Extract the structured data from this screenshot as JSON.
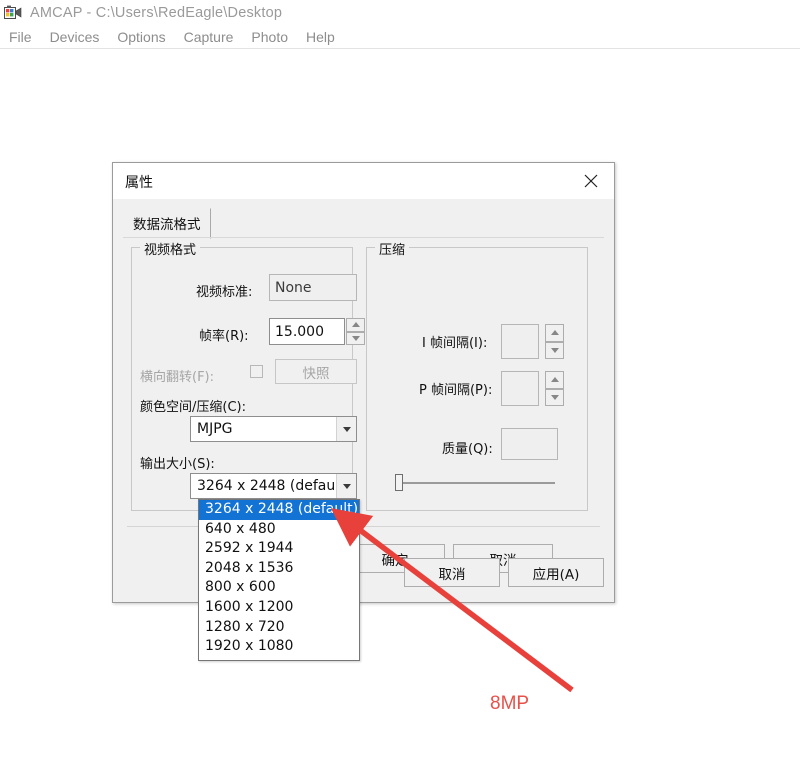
{
  "app": {
    "icon": "camcorder-icon",
    "title": "AMCAP - C:\\Users\\RedEagle\\Desktop",
    "menu": [
      {
        "label": "File"
      },
      {
        "label": "Devices"
      },
      {
        "label": "Options"
      },
      {
        "label": "Capture"
      },
      {
        "label": "Photo"
      },
      {
        "label": "Help"
      }
    ]
  },
  "dialog": {
    "title": "属性",
    "close_icon": "close-icon",
    "tabs": [
      {
        "label": "数据流格式"
      }
    ],
    "video_group": {
      "title": "视频格式",
      "video_standard_label": "视频标准:",
      "video_standard_value": "None",
      "frame_rate_label": "帧率(R):",
      "frame_rate_value": "15.000",
      "flip_horizontal_label": "横向翻转(F):",
      "flip_horizontal_checked": false,
      "snapshot_button": "快照",
      "color_space_label": "颜色空间/压缩(C):",
      "color_space_value": "MJPG",
      "output_size_label": "输出大小(S):",
      "output_size_value": "3264 x 2448  (defau"
    },
    "compression_group": {
      "title": "压缩",
      "i_frame_label": "I 帧间隔(I):",
      "i_frame_value": "",
      "p_frame_label": "P 帧间隔(P):",
      "p_frame_value": "",
      "quality_label": "质量(Q):",
      "quality_value": "",
      "quality_slider_percent": 2
    },
    "buttons": {
      "ok": "确定",
      "cancel": "取消",
      "apply": "应用(A)"
    },
    "dropdown": {
      "open": true,
      "selected_index": 0,
      "options": [
        "3264 x 2448  (default)",
        "640 x 480",
        "2592 x 1944",
        "2048 x 1536",
        "800 x 600",
        "1600 x 1200",
        "1280 x 720",
        "1920 x 1080"
      ]
    }
  },
  "annotation": {
    "label": "8MP",
    "color": "#e8514a",
    "arrow": "red-arrow-icon"
  },
  "colors": {
    "selection_blue": "#1273d5",
    "dialog_bg": "#f0f0f0",
    "annotation_red": "#e8514a",
    "menu_text": "#8d8d8d"
  }
}
